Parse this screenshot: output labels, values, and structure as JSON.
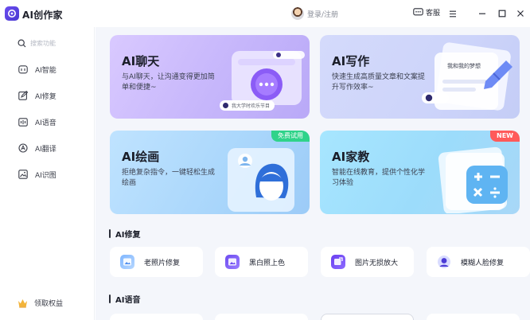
{
  "app": {
    "title": "AI创作家"
  },
  "header": {
    "login_text": "登录/注册",
    "service_label": "客服"
  },
  "sidebar": {
    "search_placeholder": "搜索功能",
    "items": [
      {
        "label": "AI智能",
        "icon": "chat-icon"
      },
      {
        "label": "AI修复",
        "icon": "edit-icon"
      },
      {
        "label": "AI语音",
        "icon": "voice-icon"
      },
      {
        "label": "AI翻译",
        "icon": "translate-icon"
      },
      {
        "label": "AI识图",
        "icon": "image-icon"
      }
    ],
    "footer_label": "领取权益"
  },
  "cards": [
    {
      "title": "AI聊天",
      "desc": "与AI聊天，让沟通变得更加简单和便捷~",
      "chip_text": "我大学时欢乐节目"
    },
    {
      "title": "AI写作",
      "desc": "快速生成高质量文章和文案提升写作效率~",
      "note_text": "我和我的梦想"
    },
    {
      "title": "AI绘画",
      "desc": "拒绝复杂指令，一键轻松生成绘画",
      "badge": "免费试用"
    },
    {
      "title": "AI家教",
      "desc": "智能在线教育，提供个性化学习体验",
      "badge": "NEW"
    }
  ],
  "sections": {
    "repair": {
      "title": "AI修复",
      "tools": [
        {
          "label": "老照片修复",
          "icon": "photo-icon"
        },
        {
          "label": "黑白照上色",
          "icon": "colorize-icon"
        },
        {
          "label": "图片无损放大",
          "icon": "enlarge-icon"
        },
        {
          "label": "模糊人脸修复",
          "icon": "face-icon"
        }
      ]
    },
    "voice": {
      "title": "AI语音"
    }
  },
  "colors": {
    "accent": "#6b5cf6",
    "badge_green": "#2fd38a",
    "badge_red": "#ff5a5a",
    "main_bg": "#f4f6fb"
  }
}
